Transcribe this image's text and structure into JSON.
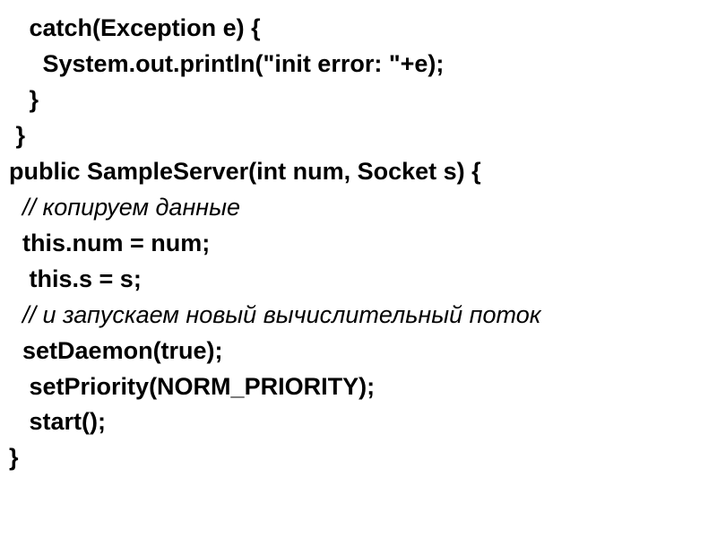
{
  "lines": [
    {
      "indent": "   ",
      "class": "bold",
      "text": "catch(Exception e) {"
    },
    {
      "indent": "     ",
      "class": "bold",
      "text": "System.out.println(\"init error: \"+e);"
    },
    {
      "indent": "   ",
      "class": "bold",
      "text": "}"
    },
    {
      "indent": " ",
      "class": "bold",
      "text": "}"
    },
    {
      "indent": "",
      "class": "bold",
      "text": "public SampleServer(int num, Socket s) {"
    },
    {
      "indent": "  ",
      "class": "italic",
      "text": "// копируем данные"
    },
    {
      "indent": "  ",
      "class": "bold",
      "text": "this.num = num;"
    },
    {
      "indent": "   ",
      "class": "bold",
      "text": "this.s = s;"
    },
    {
      "indent": "  ",
      "class": "italic",
      "text": "// и запускаем новый вычислительный поток"
    },
    {
      "indent": "  ",
      "class": "bold",
      "text": "setDaemon(true);"
    },
    {
      "indent": "   ",
      "class": "bold",
      "text": "setPriority(NORM_PRIORITY);"
    },
    {
      "indent": "   ",
      "class": "bold",
      "text": "start();"
    },
    {
      "indent": "",
      "class": "bold",
      "text": "}"
    }
  ]
}
